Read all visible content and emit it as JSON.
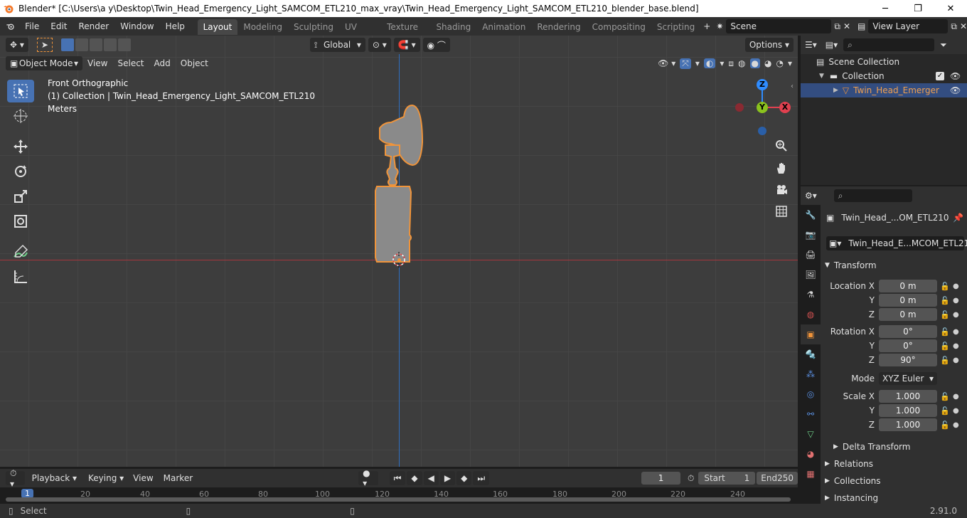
{
  "window": {
    "title": "Blender* [C:\\Users\\a y\\Desktop\\Twin_Head_Emergency_Light_SAMCOM_ETL210_max_vray\\Twin_Head_Emergency_Light_SAMCOM_ETL210_blender_base.blend]",
    "minimize": "─",
    "maximize": "❐",
    "close": "✕"
  },
  "menu": [
    "File",
    "Edit",
    "Render",
    "Window",
    "Help"
  ],
  "workspaces": [
    "Layout",
    "Modeling",
    "Sculpting",
    "UV Editing",
    "Texture Paint",
    "Shading",
    "Animation",
    "Rendering",
    "Compositing",
    "Scripting"
  ],
  "add_workspace": "+",
  "scene": {
    "value": "Scene",
    "view_layer": "View Layer"
  },
  "viewport_header": {
    "transform_orientation": "Global",
    "options": "Options",
    "mode": "Object Mode",
    "menus": [
      "View",
      "Select",
      "Add",
      "Object"
    ]
  },
  "viewport_overlay": {
    "view_name": "Front Orthographic",
    "collection_info": "(1) Collection | Twin_Head_Emergency_Light_SAMCOM_ETL210",
    "units": "Meters"
  },
  "gizmo": {
    "z": "Z",
    "y": "Y",
    "x": "X"
  },
  "outliner": {
    "scene_collection": "Scene Collection",
    "collection": "Collection",
    "object": "Twin_Head_Emerger"
  },
  "properties": {
    "object_name": "Twin_Head_...OM_ETL210",
    "data_name": "Twin_Head_E...MCOM_ETL210",
    "transform_label": "Transform",
    "location_label": "Location X",
    "rotation_label": "Rotation X",
    "scale_label": "Scale X",
    "y_label": "Y",
    "z_label": "Z",
    "location": [
      "0 m",
      "0 m",
      "0 m"
    ],
    "rotation": [
      "0°",
      "0°",
      "90°"
    ],
    "mode_label": "Mode",
    "mode_value": "XYZ Euler",
    "scale": [
      "1.000",
      "1.000",
      "1.000"
    ],
    "delta_transform": "Delta Transform",
    "relations": "Relations",
    "collections": "Collections",
    "instancing": "Instancing"
  },
  "timeline": {
    "menus": [
      "Playback",
      "Keying",
      "View",
      "Marker"
    ],
    "current_frame": "1",
    "start_label": "Start",
    "start": "1",
    "end_label": "End",
    "end": "250",
    "ruler": [
      "1",
      "20",
      "40",
      "60",
      "80",
      "100",
      "120",
      "140",
      "160",
      "180",
      "200",
      "220",
      "240"
    ]
  },
  "status": {
    "action": "Select",
    "version": "2.91.0"
  },
  "colors": {
    "accent": "#4772b3",
    "selection_outline": "#f0943a",
    "x_axis": "#e0404f",
    "y_axis": "#8ac21e",
    "z_axis": "#2f8cff"
  }
}
